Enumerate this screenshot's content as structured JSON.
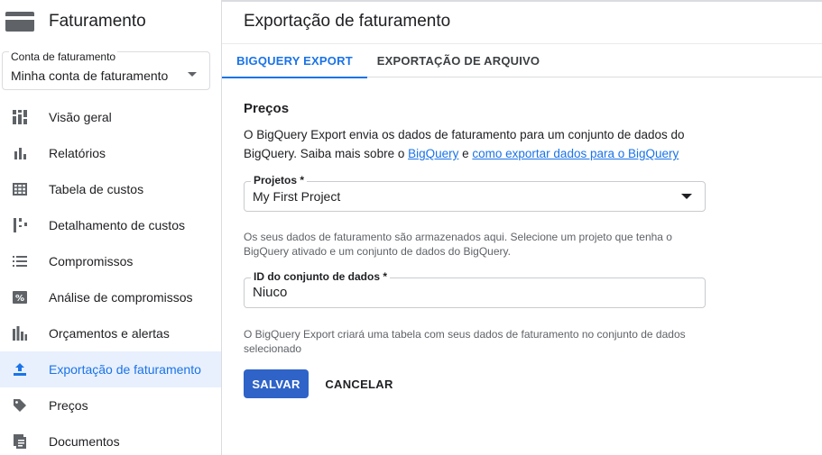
{
  "app": {
    "title": "Faturamento",
    "icon": "billing-card-icon"
  },
  "account": {
    "label": "Conta de faturamento",
    "value": "Minha conta de faturamento"
  },
  "nav": {
    "items": [
      {
        "label": "Visão geral",
        "icon": "dashboard-icon"
      },
      {
        "label": "Relatórios",
        "icon": "bar-chart-icon"
      },
      {
        "label": "Tabela de custos",
        "icon": "table-icon"
      },
      {
        "label": "Detalhamento de custos",
        "icon": "cost-breakdown-icon"
      },
      {
        "label": "Compromissos",
        "icon": "list-icon"
      },
      {
        "label": "Análise de compromissos",
        "icon": "percent-icon"
      },
      {
        "label": "Orçamentos e alertas",
        "icon": "budget-icon"
      },
      {
        "label": "Exportação de faturamento",
        "icon": "upload-icon",
        "active": true
      },
      {
        "label": "Preços",
        "icon": "tag-icon"
      },
      {
        "label": "Documentos",
        "icon": "document-icon"
      }
    ]
  },
  "main": {
    "title": "Exportação de faturamento",
    "tabs": [
      {
        "label": "BIGQUERY EXPORT",
        "active": true
      },
      {
        "label": "EXPORTAÇÃO DE ARQUIVO",
        "active": false
      }
    ],
    "section_title": "Preços",
    "description": {
      "text_before": "O BigQuery Export envia os dados de faturamento para um conjunto de dados do BigQuery. Saiba mais sobre o ",
      "link1": "BigQuery",
      "text_middle": " e ",
      "link2": "como exportar dados para o BigQuery"
    },
    "project_field": {
      "label": "Projetos *",
      "value": "My First Project"
    },
    "project_hint": "Os seus dados de faturamento são armazenados aqui. Selecione um projeto que tenha o BigQuery ativado e um conjunto de dados do BigQuery.",
    "dataset_field": {
      "label": "ID do conjunto de dados *",
      "value": "Niuco"
    },
    "dataset_hint": "O BigQuery Export criará uma tabela com seus dados de faturamento no conjunto de dados selecionado",
    "save_label": "SALVAR",
    "cancel_label": "CANCELAR"
  },
  "colors": {
    "accent": "#1a73e8",
    "primary_button": "#2f63c8",
    "active_nav_bg": "#e8f0fe",
    "text": "#202124",
    "muted_text": "#5f6368",
    "icon": "#5f6368"
  }
}
